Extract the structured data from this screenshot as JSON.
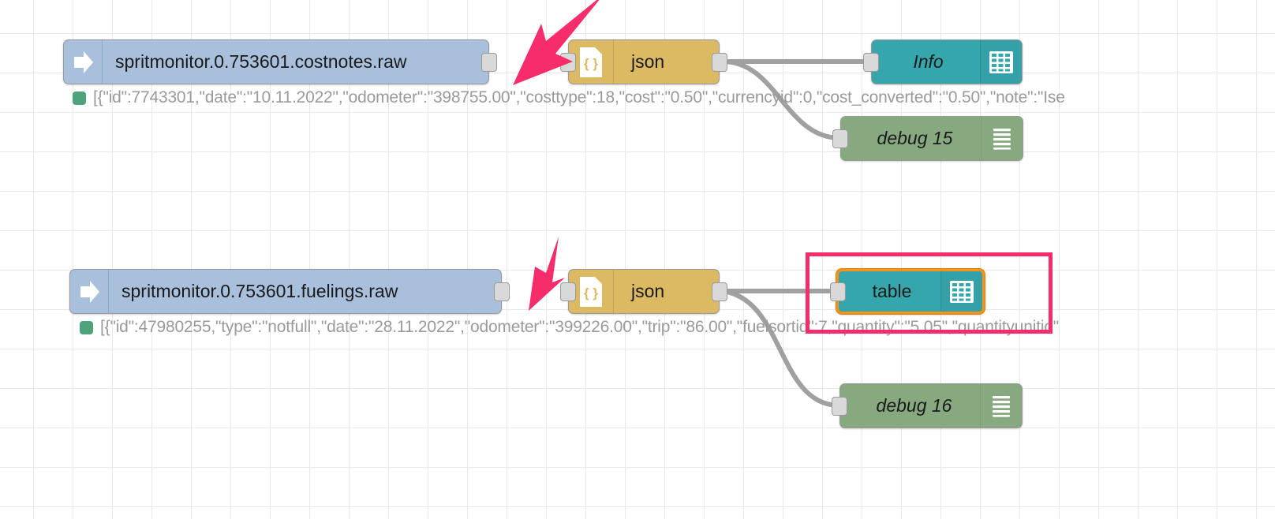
{
  "editor": {
    "name": "node-red-flow-canvas",
    "background_color": "#ffffff",
    "grid_color": "#e8e8e8"
  },
  "palette": {
    "iobroker_node": "#a9c0dd",
    "json_node": "#dcb963",
    "dashboard_node": "#36a6ad",
    "debug_node": "#87a980",
    "selection_border": "#f5941d",
    "annotation": "#f72c6b",
    "status_dot": "#4fa37a",
    "status_text": "#9a9a9a",
    "wire": "#a0a0a0"
  },
  "flows": [
    {
      "id": "flow-costnotes",
      "source": {
        "name": "spritmonitor.0.753601.costnotes.raw",
        "icon": "arrow-right-icon",
        "type": "iobroker-in"
      },
      "source_status": "[{\"id\":7743301,\"date\":\"10.11.2022\",\"odometer\":\"398755.00\",\"costtype\":18,\"cost\":\"0.50\",\"currencyid\":0,\"cost_converted\":\"0.50\",\"note\":\"Ise",
      "json": {
        "name": "json",
        "icon": "json-document-icon",
        "type": "json"
      },
      "outputs": [
        {
          "name": "Info",
          "icon": "table-grid-icon",
          "type": "ui-table",
          "italic": true,
          "selected": false
        },
        {
          "name": "debug 15",
          "icon": "debug-lines-icon",
          "type": "debug",
          "italic": true,
          "toggle": "enabled"
        }
      ]
    },
    {
      "id": "flow-fuelings",
      "source": {
        "name": "spritmonitor.0.753601.fuelings.raw",
        "icon": "arrow-right-icon",
        "type": "iobroker-in"
      },
      "source_status": "[{\"id\":47980255,\"type\":\"notfull\",\"date\":\"28.11.2022\",\"odometer\":\"399226.00\",\"trip\":\"86.00\",\"fuelsortid\":7,\"quantity\":\"5.05\",\"quantityunitid\"",
      "json": {
        "name": "json",
        "icon": "json-document-icon",
        "type": "json"
      },
      "outputs": [
        {
          "name": "table",
          "icon": "table-grid-icon",
          "type": "ui-table",
          "italic": false,
          "selected": true
        },
        {
          "name": "debug 16",
          "icon": "debug-lines-icon",
          "type": "debug",
          "italic": true,
          "toggle": "enabled"
        }
      ]
    }
  ],
  "annotations": {
    "arrows": [
      {
        "name": "arrow-pointing-to-json-costnotes",
        "color": "#f72c6b"
      },
      {
        "name": "arrow-pointing-to-json-fuelings",
        "color": "#f72c6b"
      }
    ],
    "highlight_rect": {
      "name": "highlight-around-table-node",
      "color": "#f72c6b"
    }
  }
}
